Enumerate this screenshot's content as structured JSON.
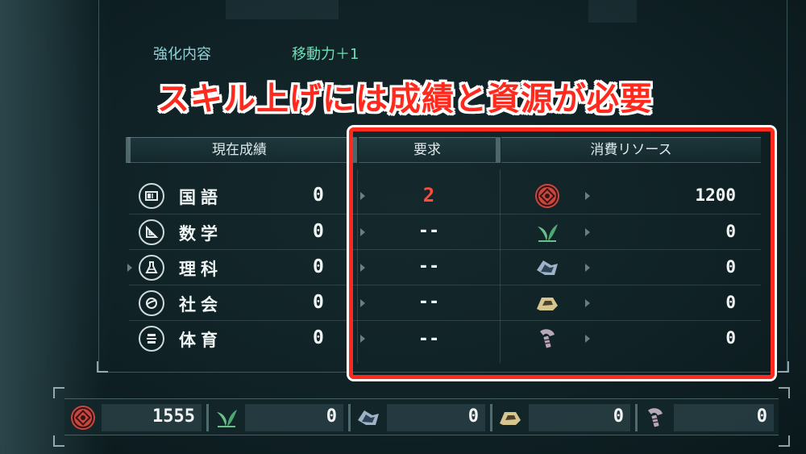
{
  "enhancement": {
    "label": "強化内容",
    "value": "移動力＋1"
  },
  "headline": "スキル上げには成績と資源が必要",
  "table": {
    "headers": {
      "scores": "現在成績",
      "required": "要求",
      "resources": "消費リソース"
    },
    "rows": [
      {
        "subject": "国語",
        "icon": "book-icon",
        "score": "0",
        "required": "2",
        "resource_icon": "coin-emblem-icon",
        "cost": "1200"
      },
      {
        "subject": "数学",
        "icon": "triangle-ruler-icon",
        "score": "0",
        "required": "--",
        "resource_icon": "leaf-sprout-icon",
        "cost": "0"
      },
      {
        "subject": "理科",
        "icon": "flask-icon",
        "score": "0",
        "required": "--",
        "resource_icon": "cloth-icon",
        "cost": "0"
      },
      {
        "subject": "社会",
        "icon": "globe-icon",
        "score": "0",
        "required": "--",
        "resource_icon": "ore-icon",
        "cost": "0"
      },
      {
        "subject": "体育",
        "icon": "pe-icon",
        "score": "0",
        "required": "--",
        "resource_icon": "screw-icon",
        "cost": "0"
      }
    ]
  },
  "resource_bar": [
    {
      "icon": "coin-emblem-icon",
      "value": "1555"
    },
    {
      "icon": "leaf-sprout-icon",
      "value": "0"
    },
    {
      "icon": "cloth-icon",
      "value": "0"
    },
    {
      "icon": "ore-icon",
      "value": "0"
    },
    {
      "icon": "screw-icon",
      "value": "0"
    }
  ],
  "colors": {
    "headline_red": "#ff2a1e",
    "required_red": "#ff4b3a",
    "coin": "#c8473f",
    "leaf": "#6bc08a",
    "cloth": "#9fb3c8",
    "ore": "#d6c58e",
    "screw": "#b8a7b9"
  }
}
